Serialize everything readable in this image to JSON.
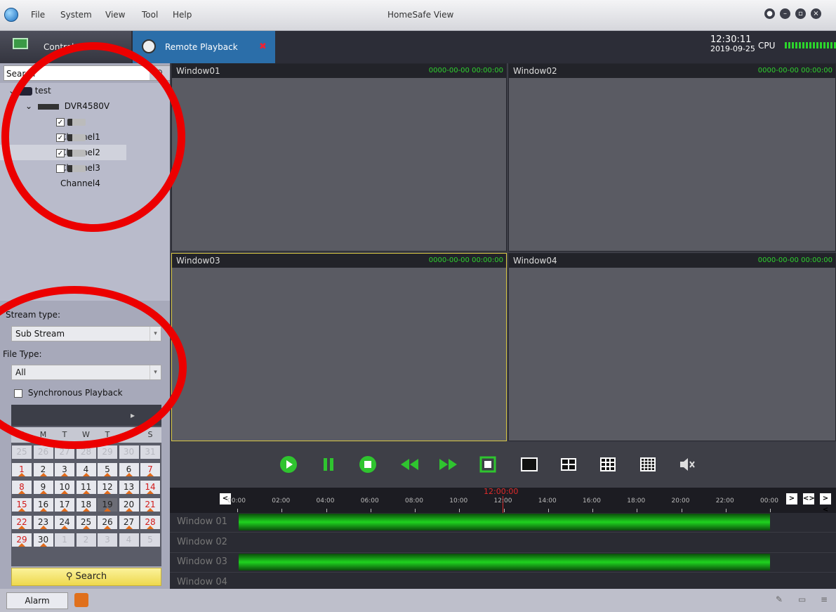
{
  "menu": {
    "items": [
      "File",
      "System",
      "View",
      "Tool",
      "Help"
    ],
    "app_title": "HomeSafe View"
  },
  "window_buttons": [
    "lock-icon",
    "minimize-icon",
    "restore-icon",
    "close-icon"
  ],
  "tabs": {
    "control_panel": "Control Panel",
    "remote_playback": "Remote Playback"
  },
  "status": {
    "time": "12:30:11",
    "date": "2019-09-25",
    "cpu_label": "CPU"
  },
  "sidebar": {
    "search_placeholder": "Search",
    "tree": {
      "root": "test",
      "device": "DVR4580V",
      "channels": [
        {
          "label": "Channel1",
          "checked": true
        },
        {
          "label": "Channel2",
          "checked": true
        },
        {
          "label": "Channel3",
          "checked": true,
          "selected": true
        },
        {
          "label": "Channel4",
          "checked": false
        }
      ]
    },
    "stream_type_label": "Stream type:",
    "stream_type_value": "Sub Stream",
    "file_type_label": "File Type:",
    "file_type_value": "All",
    "sync_label": "Synchronous Playback",
    "calendar": {
      "days_of_week": [
        "S",
        "M",
        "T",
        "W",
        "T",
        "F",
        "S"
      ],
      "weeks": [
        [
          [
            "25",
            "other"
          ],
          [
            "26",
            "other"
          ],
          [
            "27",
            "other"
          ],
          [
            "28",
            "other"
          ],
          [
            "29",
            "other"
          ],
          [
            "30",
            "other"
          ],
          [
            "31",
            "other"
          ]
        ],
        [
          [
            "1",
            "sun"
          ],
          [
            "2",
            ""
          ],
          [
            "3",
            ""
          ],
          [
            "4",
            ""
          ],
          [
            "5",
            ""
          ],
          [
            "6",
            ""
          ],
          [
            "7",
            "sat"
          ]
        ],
        [
          [
            "8",
            "sun"
          ],
          [
            "9",
            ""
          ],
          [
            "10",
            ""
          ],
          [
            "11",
            ""
          ],
          [
            "12",
            ""
          ],
          [
            "13",
            ""
          ],
          [
            "14",
            "sat"
          ]
        ],
        [
          [
            "15",
            "sun"
          ],
          [
            "16",
            ""
          ],
          [
            "17",
            ""
          ],
          [
            "18",
            ""
          ],
          [
            "19",
            "today"
          ],
          [
            "20",
            ""
          ],
          [
            "21",
            "sat"
          ]
        ],
        [
          [
            "22",
            "sun"
          ],
          [
            "23",
            ""
          ],
          [
            "24",
            ""
          ],
          [
            "25",
            ""
          ],
          [
            "26",
            ""
          ],
          [
            "27",
            ""
          ],
          [
            "28",
            "sat"
          ]
        ],
        [
          [
            "29",
            "sun"
          ],
          [
            "30",
            ""
          ],
          [
            "1",
            "other"
          ],
          [
            "2",
            "other"
          ],
          [
            "3",
            "other"
          ],
          [
            "4",
            "other"
          ],
          [
            "5",
            "other"
          ]
        ]
      ]
    },
    "search_button": "Search"
  },
  "windows": [
    {
      "name": "Window01",
      "timestamp": "0000-00-00 00:00:00"
    },
    {
      "name": "Window02",
      "timestamp": "0000-00-00 00:00:00"
    },
    {
      "name": "Window03",
      "timestamp": "0000-00-00 00:00:00"
    },
    {
      "name": "Window04",
      "timestamp": "0000-00-00 00:00:00"
    }
  ],
  "timeline": {
    "current_time": "12:00:00",
    "ticks": [
      "00:00",
      "02:00",
      "04:00",
      "06:00",
      "08:00",
      "10:00",
      "12:00",
      "14:00",
      "16:00",
      "18:00",
      "20:00",
      "22:00",
      "00:00"
    ],
    "rows": [
      {
        "label": "Window 01",
        "has_recording": true
      },
      {
        "label": "Window 02",
        "has_recording": false
      },
      {
        "label": "Window 03",
        "has_recording": true
      },
      {
        "label": "Window 04",
        "has_recording": false
      }
    ]
  },
  "footer": {
    "alarm": "Alarm"
  },
  "colors": {
    "accent": "#2b6ea9",
    "recording": "#1fd31f",
    "annotation": "#ec0000"
  }
}
